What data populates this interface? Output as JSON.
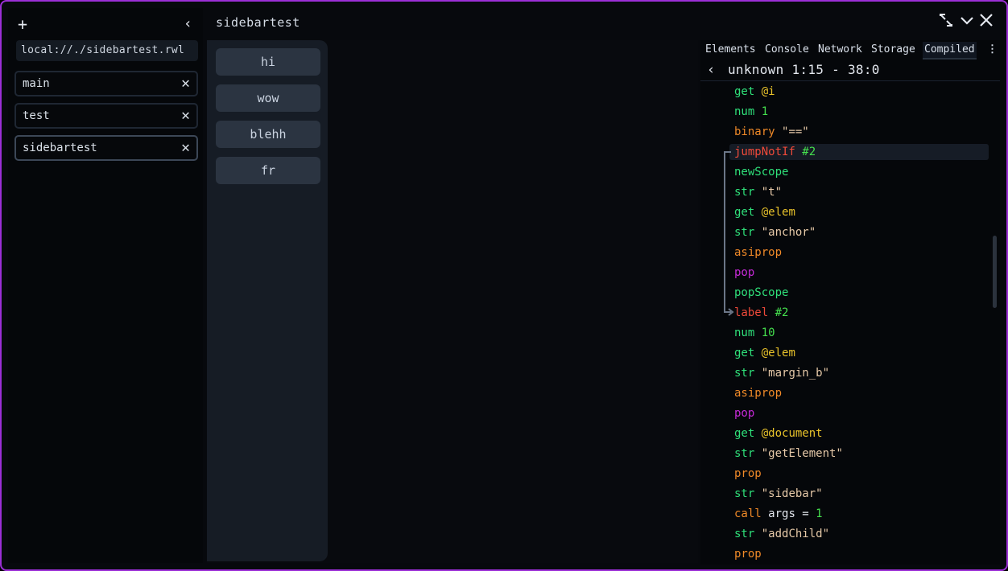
{
  "sidebar": {
    "url": "local://./sidebartest.rwl",
    "tabs": [
      {
        "label": "main"
      },
      {
        "label": "test"
      },
      {
        "label": "sidebartest"
      }
    ]
  },
  "window": {
    "title": "sidebartest"
  },
  "page_sidebar": {
    "buttons": [
      "hi",
      "wow",
      "blehh",
      "fr"
    ]
  },
  "devtools": {
    "tabs": [
      "Elements",
      "Console",
      "Network",
      "Storage",
      "Compiled"
    ],
    "active_tab": "Compiled",
    "location": "unknown 1:15 - 38:0",
    "lines": [
      {
        "op": "get",
        "arg": "@i",
        "arg_type": "var"
      },
      {
        "op": "num",
        "arg": "1",
        "arg_type": "num"
      },
      {
        "op": "binary",
        "arg": "\"==\"",
        "arg_type": "str"
      },
      {
        "op": "jumpNotIf",
        "arg": "#2",
        "arg_type": "num"
      },
      {
        "op": "newScope",
        "arg": "",
        "arg_type": "plain"
      },
      {
        "op": "str",
        "arg": "\"t\"",
        "arg_type": "str"
      },
      {
        "op": "get",
        "arg": "@elem",
        "arg_type": "var"
      },
      {
        "op": "str",
        "arg": "\"anchor\"",
        "arg_type": "str"
      },
      {
        "op": "asiprop",
        "arg": "",
        "arg_type": "plain"
      },
      {
        "op": "pop",
        "arg": "",
        "arg_type": "plain"
      },
      {
        "op": "popScope",
        "arg": "",
        "arg_type": "plain"
      },
      {
        "op": "label",
        "arg": "#2",
        "arg_type": "num"
      },
      {
        "op": "num",
        "arg": "10",
        "arg_type": "num"
      },
      {
        "op": "get",
        "arg": "@elem",
        "arg_type": "var"
      },
      {
        "op": "str",
        "arg": "\"margin_b\"",
        "arg_type": "str"
      },
      {
        "op": "asiprop",
        "arg": "",
        "arg_type": "plain"
      },
      {
        "op": "pop",
        "arg": "",
        "arg_type": "plain"
      },
      {
        "op": "get",
        "arg": "@document",
        "arg_type": "var"
      },
      {
        "op": "str",
        "arg": "\"getElement\"",
        "arg_type": "str"
      },
      {
        "op": "prop",
        "arg": "",
        "arg_type": "plain"
      },
      {
        "op": "str",
        "arg": "\"sidebar\"",
        "arg_type": "str"
      },
      {
        "op": "call",
        "arg": "args = ",
        "arg2": "1",
        "arg_type": "plain"
      },
      {
        "op": "str",
        "arg": "\"addChild\"",
        "arg_type": "str"
      },
      {
        "op": "prop",
        "arg": "",
        "arg_type": "plain"
      }
    ]
  },
  "colors": {
    "frame_border": "#9b2fd6",
    "op_green": "#2fe07a",
    "op_orange": "#f08a28",
    "op_pop": "#c72ad8",
    "op_jump": "#f04a3a",
    "var_yellow": "#e8c22a"
  }
}
